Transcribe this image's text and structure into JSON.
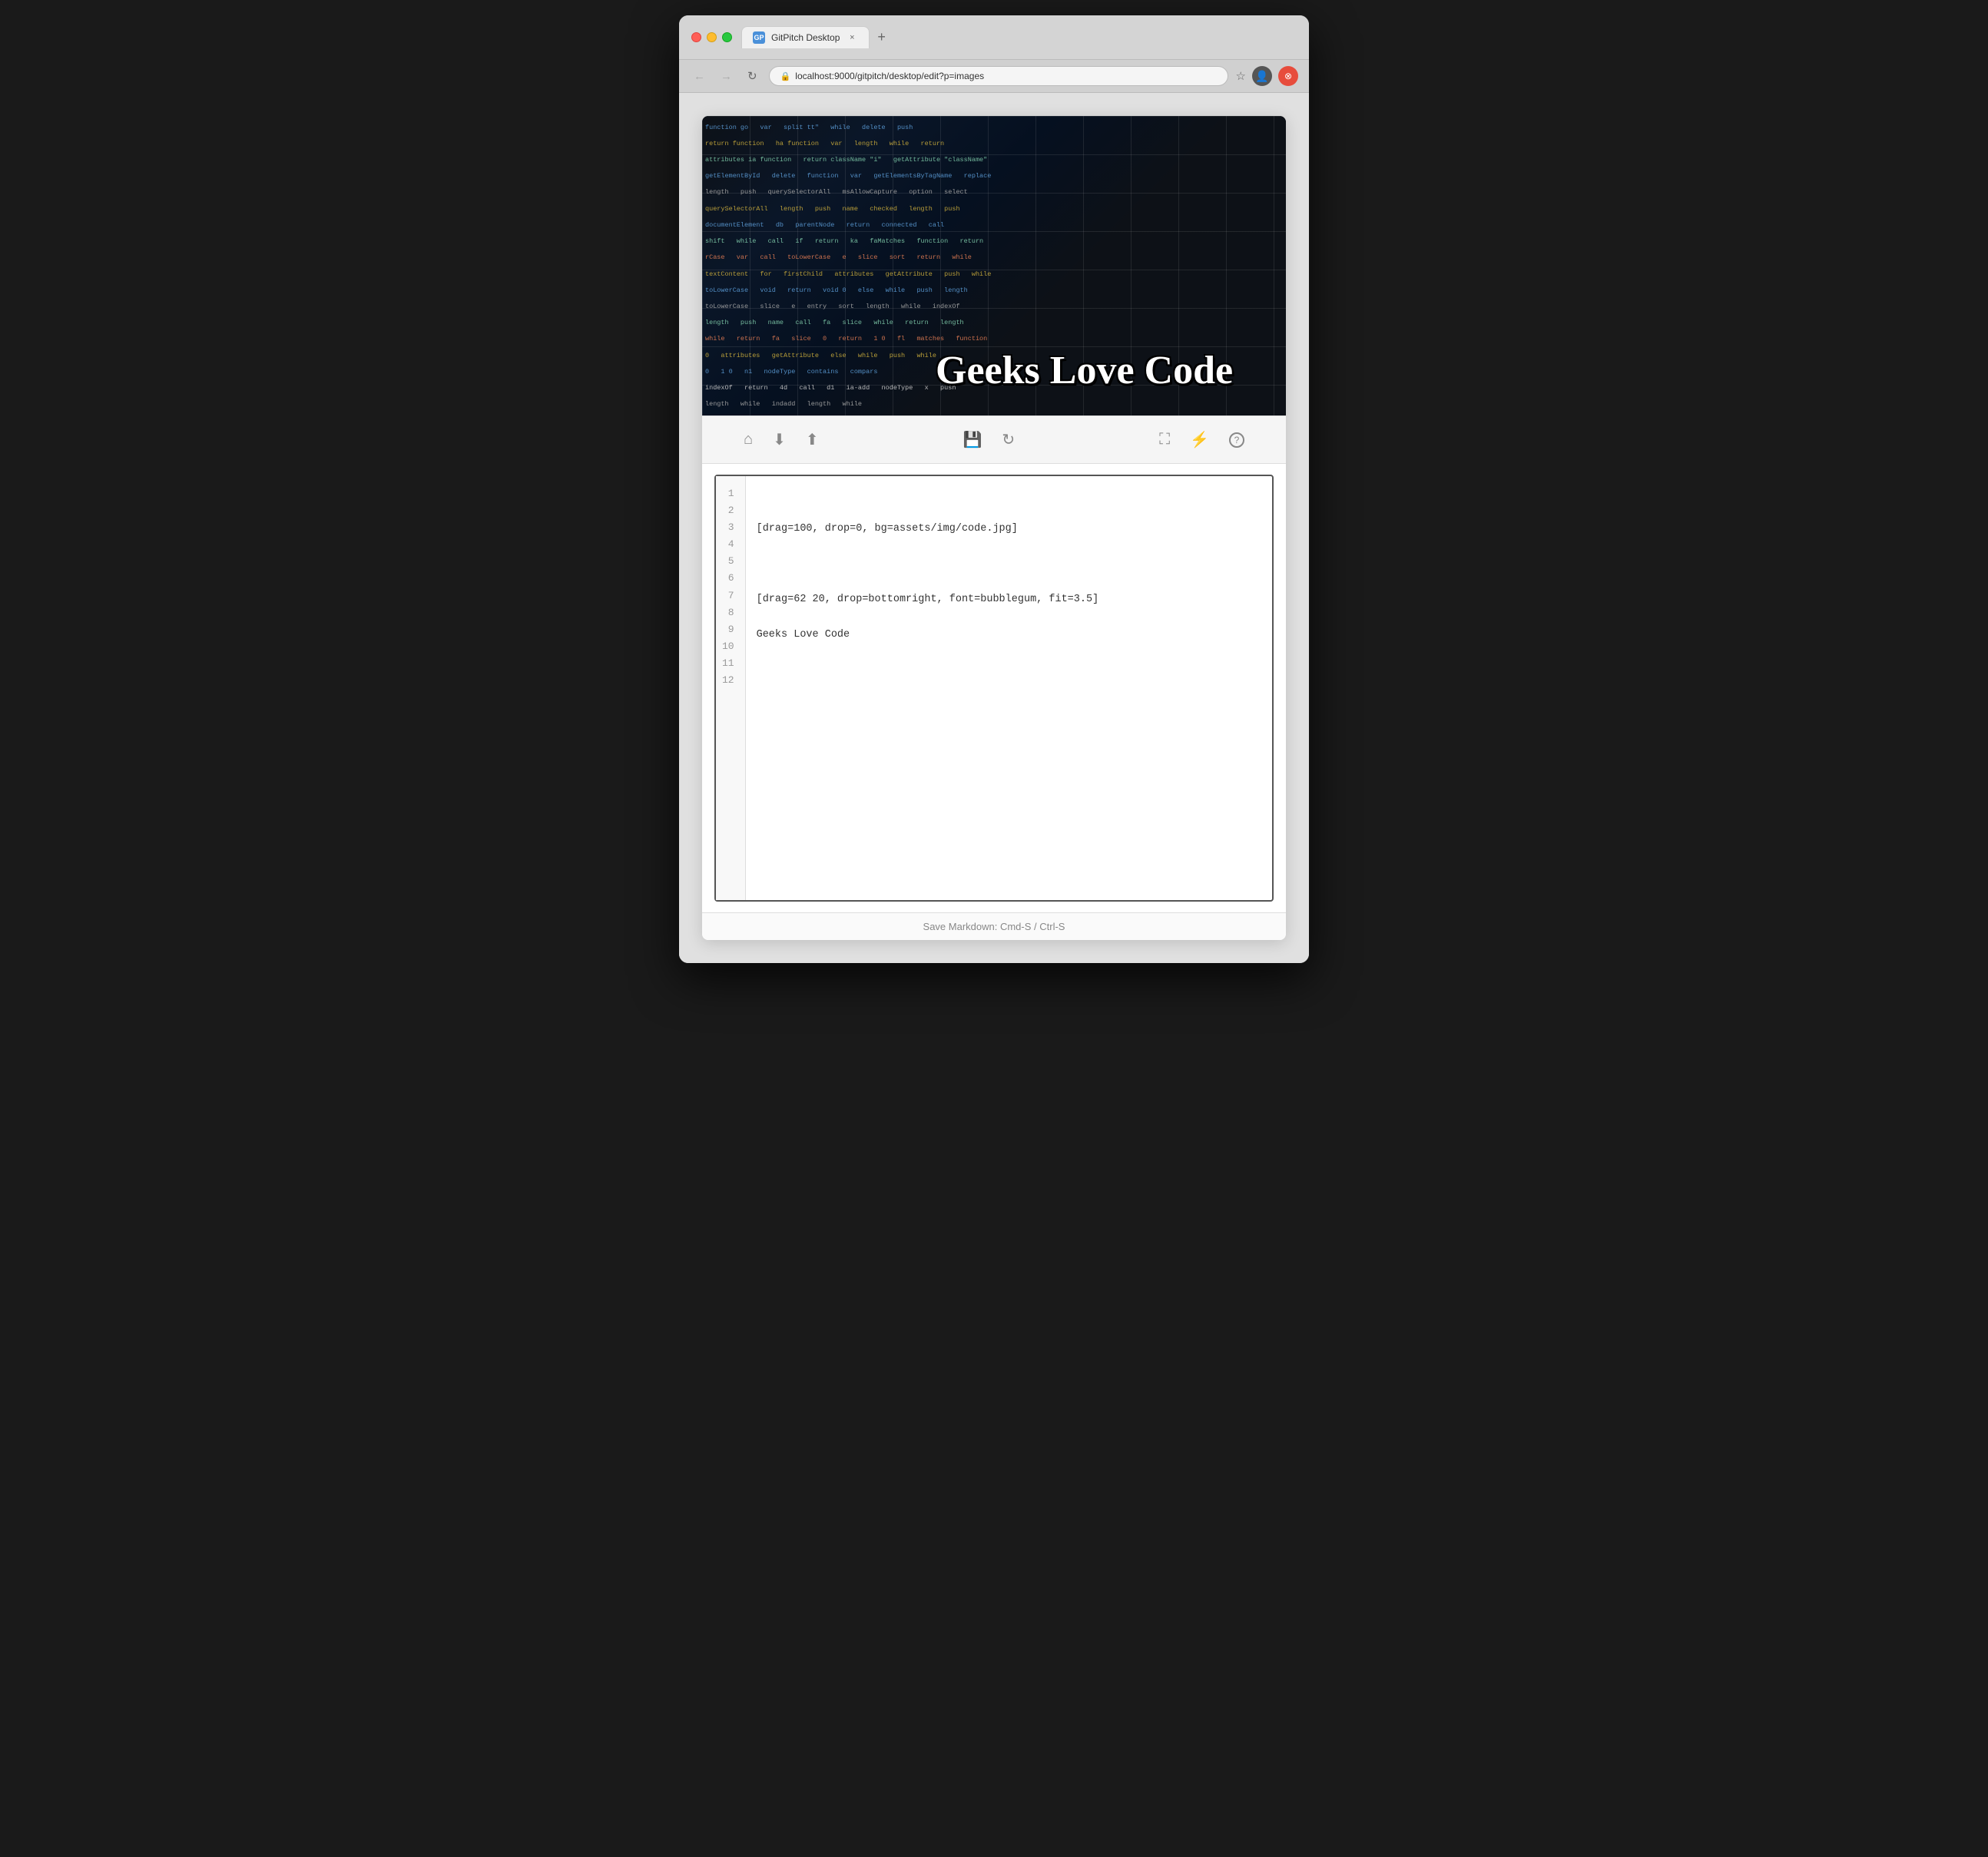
{
  "browser": {
    "traffic_lights": {
      "close_label": "×",
      "minimize_label": "–",
      "maximize_label": "+"
    },
    "tab": {
      "favicon_label": "GP",
      "title": "GitPitch Desktop",
      "close_label": "×",
      "new_tab_label": "+"
    },
    "nav": {
      "back_label": "←",
      "forward_label": "→",
      "refresh_label": "↻",
      "lock_icon": "🔒",
      "url": "localhost:9000/gitpitch/desktop/edit?p=images",
      "bookmark_label": "☆",
      "new_tab_label": "+"
    }
  },
  "toolbar": {
    "home_icon": "⌂",
    "download_icon": "⬇",
    "upload_icon": "⬆",
    "save_icon": "💾",
    "refresh_icon": "↻",
    "expand_icon": "⛶",
    "lightning_icon": "⚡",
    "help_icon": "?"
  },
  "slide": {
    "title": "Geeks Love Code",
    "bg_image_alt": "Code background"
  },
  "editor": {
    "lines": [
      {
        "number": "1",
        "content": ""
      },
      {
        "number": "2",
        "content": "[drag=100, drop=0, bg=assets/img/code.jpg]"
      },
      {
        "number": "3",
        "content": ""
      },
      {
        "number": "4",
        "content": "[drag=62 20, drop=bottomright, font=bubblegum, fit=3.5]"
      },
      {
        "number": "5",
        "content": "Geeks Love Code"
      },
      {
        "number": "6",
        "content": ""
      },
      {
        "number": "7",
        "content": ""
      },
      {
        "number": "8",
        "content": ""
      },
      {
        "number": "9",
        "content": ""
      },
      {
        "number": "10",
        "content": ""
      },
      {
        "number": "11",
        "content": ""
      },
      {
        "number": "12",
        "content": ""
      }
    ]
  },
  "status_bar": {
    "text": "Save Markdown: Cmd-S / Ctrl-S"
  },
  "code_bg_lines": [
    {
      "content": "    function go    var    split tt\"    while    delete    push",
      "colors": [
        "#c9d1d9",
        "#79c0ff",
        "#c9d1d9",
        "#d2a8ff",
        "#c9d1d9",
        "#ff7b72",
        "#79c0ff"
      ]
    },
    {
      "content": "return function    ha function    var    length    while    return",
      "colors": [
        "#ff7b72",
        "#c9d1d9",
        "#79c0ff",
        "#c9d1d9",
        "#ffa657",
        "#c9d1d9",
        "#ff7b72"
      ]
    },
    {
      "content": "attributes ia function    return className \"i\"    getAttribute \"className\"",
      "colors": [
        "#c9d1d9",
        "#79c0ff",
        "#c9d1d9",
        "#d2a8ff",
        "#a5d6ff",
        "#d2a8ff"
      ]
    },
    {
      "content": "    getElementById    delete    function    var    getElementsByTagName    replace",
      "colors": [
        "#79c0ff",
        "#ff7b72",
        "#c9d1d9",
        "#d2a8ff",
        "#79c0ff",
        "#ff7b72"
      ]
    },
    {
      "content": "    length    push    querySelectorAll    msAllowCapture    option    select",
      "colors": [
        "#ffa657",
        "#79c0ff",
        "#d2a8ff",
        "#c9d1d9",
        "#a5d6ff",
        "#c9d1d9"
      ]
    },
    {
      "content": "querySelectorAll    length    push    name    checked    length    push",
      "colors": [
        "#d2a8ff",
        "#ffa657",
        "#79c0ff",
        "#a5d6ff",
        "#c9d1d9",
        "#ffa657",
        "#79c0ff"
      ]
    },
    {
      "content": "    documentElement    db    parentNode    return    connected    call",
      "colors": [
        "#79c0ff",
        "#c9d1d9",
        "#d2a8ff",
        "#ff7b72",
        "#c9d1d9",
        "#79c0ff"
      ]
    },
    {
      "content": "shift    while    call    if    return    ka    faMatches    function    return",
      "colors": [
        "#79c0ff",
        "#ff7b72",
        "#c9d1d9",
        "#ff7b72",
        "#ff7b72",
        "#c9d1d9",
        "#d2a8ff",
        "#79c0ff"
      ]
    },
    {
      "content": "rCase    var    call    toLowerCase    e    slice    sort    return    while",
      "colors": [
        "#c9d1d9",
        "#d2a8ff",
        "#79c0ff",
        "#ffa657",
        "#c9d1d9",
        "#79c0ff",
        "#d2a8ff",
        "#ff7b72"
      ]
    },
    {
      "content": "textContent    for    firstChild    attributes    getAttribute    push    while",
      "colors": [
        "#79c0ff",
        "#ff7b72",
        "#c9d1d9",
        "#d2a8ff",
        "#79c0ff",
        "#ffa657",
        "#ff7b72"
      ]
    },
    {
      "content": "    toLowerCase    void    return    void 0    else    while    push    length",
      "colors": [
        "#ffa657",
        "#c9d1d9",
        "#ff7b72",
        "#c9d1d9",
        "#ff7b72",
        "#79c0ff",
        "#ffa657"
      ]
    },
    {
      "content": "    toLowerCase    slice    e    entry    sort    length    while    indexOf",
      "colors": [
        "#ffa657",
        "#79c0ff",
        "#c9d1d9",
        "#d2a8ff",
        "#ff7b72",
        "#ffa657",
        "#79c0ff"
      ]
    }
  ]
}
